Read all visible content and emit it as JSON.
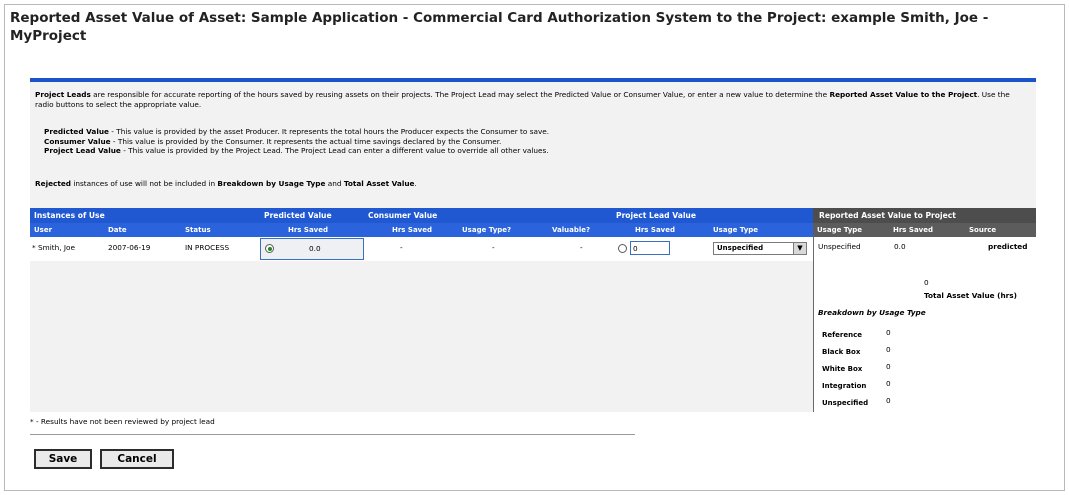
{
  "title": "Reported Asset Value of Asset: Sample Application - Commercial Card Authorization System to the Project: example Smith, Joe - MyProject",
  "intro": {
    "lead_bold": "Project Leads",
    "text1": " are responsible for accurate reporting of the hours saved by reusing assets on their projects. The Project Lead may select the Predicted Value or Consumer Value, or enter a new value to determine the ",
    "rav_bold": "Reported Asset Value to the Project",
    "text2": ". Use the radio buttons to select the appropriate value."
  },
  "definitions": [
    {
      "term": "Predicted Value",
      "text": " - This value is provided by the asset Producer. It represents the total hours the Producer expects the Consumer to save."
    },
    {
      "term": "Consumer Value",
      "text": " - This value is provided by the Consumer. It represents the actual time savings declared by the Consumer."
    },
    {
      "term": "Project Lead Value",
      "text": " - This value is provided by the Project Lead. The Project Lead can enter a different value to override all other values."
    }
  ],
  "rejected": {
    "term": "Rejected",
    "text1": " instances of use will not be included in ",
    "b1": "Breakdown by Usage Type",
    "text2": " and ",
    "b2": "Total Asset Value",
    "text3": "."
  },
  "table": {
    "group_headers": {
      "instances": "Instances of Use",
      "predicted": "Predicted Value",
      "consumer": "Consumer Value",
      "project_lead": "Project Lead Value",
      "reported": "Reported Asset Value to Project"
    },
    "columns": {
      "user": "User",
      "date": "Date",
      "status": "Status",
      "pv_hrs": "Hrs Saved",
      "cv_hrs": "Hrs Saved",
      "cv_usage": "Usage Type?",
      "cv_valuable": "Valuable?",
      "pl_hrs": "Hrs Saved",
      "pl_usage": "Usage Type",
      "r_usage": "Usage Type",
      "r_hrs": "Hrs Saved",
      "r_source": "Source"
    },
    "row": {
      "user": "* Smith, Joe",
      "date": "2007-06-19",
      "status": "IN PROCESS",
      "pv_hrs": "0.0",
      "cv_hrs": "-",
      "cv_usage": "-",
      "cv_valuable": "-",
      "pl_hrs": "0",
      "pl_usage": "Unspecified",
      "r_usage": "Unspecified",
      "r_hrs": "0.0",
      "r_source": "predicted"
    }
  },
  "summary": {
    "total_value": "0",
    "total_label": "Total Asset Value (hrs)",
    "breakdown_title": "Breakdown by Usage Type",
    "breakdown": [
      {
        "label": "Reference",
        "value": "0"
      },
      {
        "label": "Black Box",
        "value": "0"
      },
      {
        "label": "White Box",
        "value": "0"
      },
      {
        "label": "Integration",
        "value": "0"
      },
      {
        "label": "Unspecified",
        "value": "0"
      }
    ]
  },
  "footnote": "* - Results have not been reviewed by project lead",
  "buttons": {
    "save": "Save",
    "cancel": "Cancel"
  },
  "colors": {
    "header_blue": "#2058d2",
    "header_gray": "#4d4d4d",
    "accent_bar": "#1a54c9"
  }
}
